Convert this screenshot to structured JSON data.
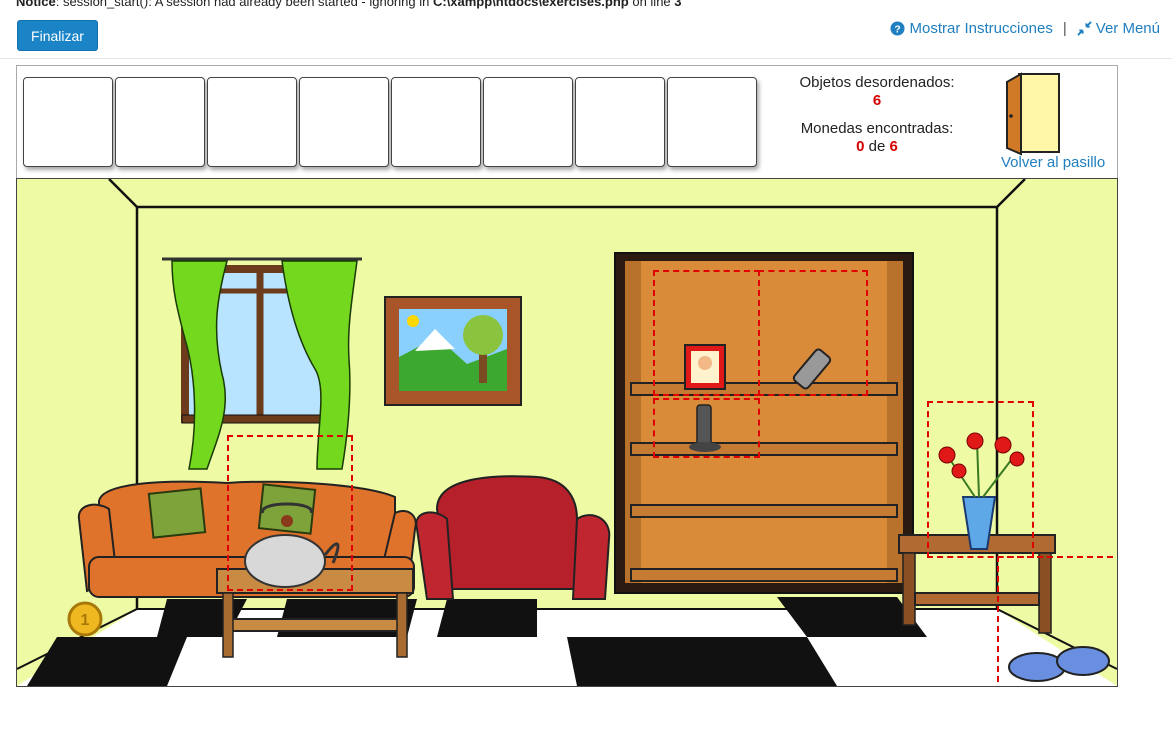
{
  "notice": {
    "label": "Notice",
    "message": ": session_start(): A session had already been started - ignoring in ",
    "path": "C:\\xampp\\htdocs\\exercises.php",
    "on_line": " on line ",
    "line": "3"
  },
  "toolbar": {
    "finalizar_label": "Finalizar",
    "instrucciones_label": "Mostrar Instrucciones",
    "separator": "|",
    "menu_label": "Ver Menú"
  },
  "status": {
    "desordenados_label": "Objetos desordenados:",
    "desordenados_value": "6",
    "monedas_label": "Monedas encontradas:",
    "monedas_found": "0",
    "monedas_de": "de",
    "monedas_total": "6"
  },
  "volver_label": "Volver al pasillo",
  "inventory_slot_count": 8,
  "coin_label": "1",
  "icons": {
    "instrucciones": "question-circle-icon",
    "menu": "compress-arrows-icon",
    "door": "door-icon"
  },
  "colors": {
    "accent": "#1a84c7",
    "link": "#1f7fc0",
    "count_red": "#d40000",
    "wall": "#eefaa4",
    "hotspot": "#e00000"
  }
}
